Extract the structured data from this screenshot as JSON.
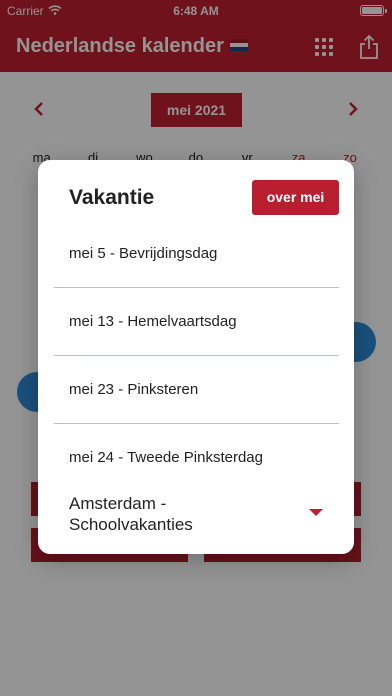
{
  "status_bar": {
    "carrier": "Carrier",
    "time": "6:48 AM"
  },
  "nav": {
    "title": "Nederlandse kalender",
    "flag_colors": [
      "#ae1c28",
      "#ffffff",
      "#21468b"
    ],
    "grid_icon": "grid-icon",
    "share_icon": "share-icon"
  },
  "calendar": {
    "month_label": "mei 2021",
    "weekdays": [
      "ma",
      "di",
      "wo",
      "do",
      "vr",
      "za",
      "zo"
    ]
  },
  "dialog": {
    "title": "Vakantie",
    "about_button": "over mei",
    "holidays": [
      "mei 5 - Bevrijdingsdag",
      "mei 13 - Hemelvaartsdag",
      "mei 23 - Pinksteren",
      "mei 24 - Tweede Pinksterdag"
    ],
    "region_select": "Amsterdam - Schoolvakanties"
  },
  "colors": {
    "brand": "#c01f2f",
    "today": "#2d8bd8"
  }
}
